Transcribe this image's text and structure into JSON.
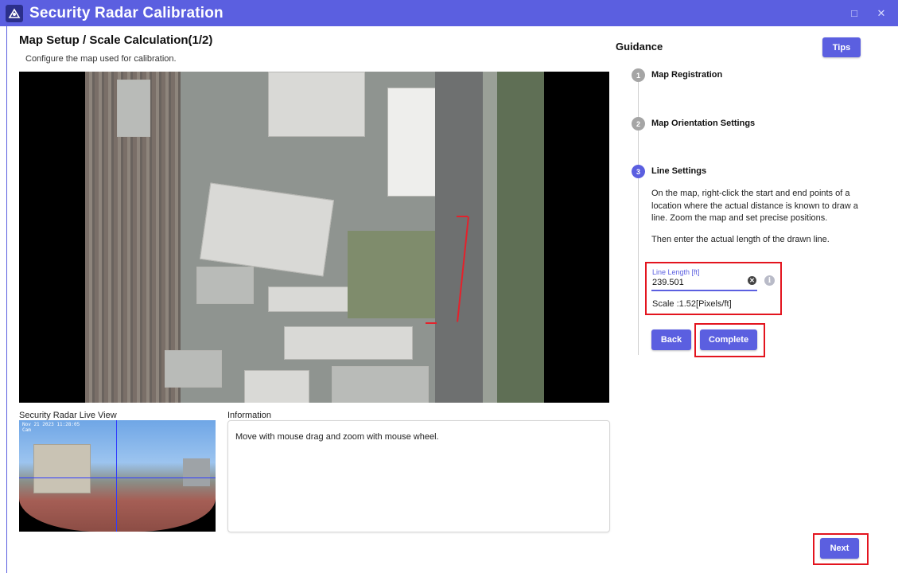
{
  "window": {
    "title": "Security Radar Calibration",
    "maximize_glyph": "□",
    "close_glyph": "✕"
  },
  "page": {
    "title": "Map Setup / Scale Calculation(1/2)",
    "subtitle": "Configure the map used for calibration."
  },
  "live_view": {
    "label": "Security Radar Live View",
    "timestamp": "Nov 21 2023 11:28:05",
    "camera": "Cam"
  },
  "information": {
    "label": "Information",
    "text": "Move with mouse drag and zoom with mouse wheel."
  },
  "guidance": {
    "title": "Guidance",
    "tips_label": "Tips",
    "steps": [
      {
        "number": "1",
        "label": "Map Registration"
      },
      {
        "number": "2",
        "label": "Map Orientation Settings"
      },
      {
        "number": "3",
        "label": "Line Settings"
      }
    ],
    "description": "On the map, right-click the start and end points of a location where the actual distance is known to draw a line. Zoom the map and set precise positions.",
    "description2": "Then enter the actual length of the drawn line.",
    "line_length_label": "Line Length [ft]",
    "line_length_value": "239.501",
    "scale_text": "Scale :1.52[Pixels/ft]",
    "back_label": "Back",
    "complete_label": "Complete"
  },
  "footer": {
    "next_label": "Next"
  },
  "colors": {
    "accent": "#5b5fe0",
    "highlight": "#e3141e",
    "step_inactive": "#a5a5a5",
    "calibration_line": "#e5212b"
  }
}
